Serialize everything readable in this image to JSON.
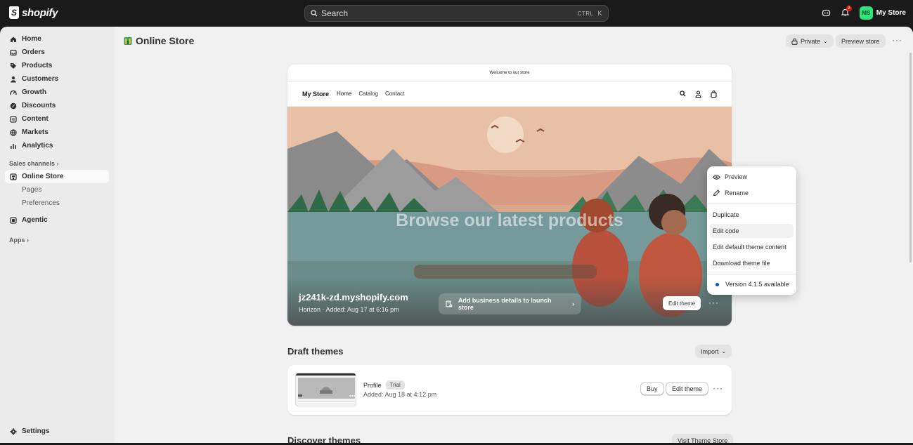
{
  "topbar": {
    "logo_text": "shopify",
    "search_placeholder": "Search",
    "shortcut_mod": "CTRL",
    "shortcut_key": "K",
    "notification_count": "2",
    "avatar_initials": "MS",
    "store_name": "My Store"
  },
  "sidebar": {
    "items": [
      {
        "label": "Home",
        "icon": "home-icon"
      },
      {
        "label": "Orders",
        "icon": "inbox-icon"
      },
      {
        "label": "Products",
        "icon": "tag-icon"
      },
      {
        "label": "Customers",
        "icon": "person-icon"
      },
      {
        "label": "Growth",
        "icon": "gauge-icon"
      },
      {
        "label": "Discounts",
        "icon": "discount-icon"
      },
      {
        "label": "Content",
        "icon": "content-icon"
      },
      {
        "label": "Markets",
        "icon": "globe-icon"
      },
      {
        "label": "Analytics",
        "icon": "bar-chart-icon"
      }
    ],
    "sales_channels_label": "Sales channels",
    "online_store_label": "Online Store",
    "pages_label": "Pages",
    "preferences_label": "Preferences",
    "agentic_label": "Agentic",
    "apps_label": "Apps",
    "settings_label": "Settings"
  },
  "main": {
    "page_title": "Online Store",
    "private_label": "Private",
    "preview_store_label": "Preview store"
  },
  "theme_preview": {
    "announcement": "Welcome to our store",
    "brand": "My Store",
    "nav_links": [
      "Home",
      "Catalog",
      "Contact"
    ],
    "hero_title": "Browse our latest products"
  },
  "current_theme": {
    "domain": "jz241k-zd.myshopify.com",
    "meta": "Horizon · Added: Aug 17 at 6:16 pm",
    "launch_label": "Add business details to launch store",
    "edit_label": "Edit theme"
  },
  "menu": {
    "preview": "Preview",
    "rename": "Rename",
    "duplicate": "Duplicate",
    "edit_code": "Edit code",
    "edit_default": "Edit default theme content",
    "download": "Download theme file",
    "version": "Version 4.1.5 available"
  },
  "draft": {
    "title": "Draft themes",
    "import_label": "Import",
    "name": "Profile",
    "badge": "Trial",
    "date": "Added: Aug 18 at 4:12 pm",
    "buy_label": "Buy",
    "edit_label": "Edit theme"
  },
  "discover": {
    "title": "Discover themes",
    "visit_label": "Visit Theme Store"
  }
}
